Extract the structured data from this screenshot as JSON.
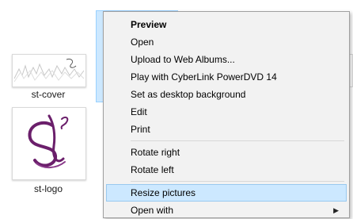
{
  "files": [
    {
      "name": "st-cover"
    },
    {
      "name": "st-logo"
    }
  ],
  "context_menu": {
    "items": [
      {
        "label": "Preview",
        "bold": true
      },
      {
        "label": "Open"
      },
      {
        "label": "Upload to Web Albums..."
      },
      {
        "label": "Play with CyberLink PowerDVD 14"
      },
      {
        "label": "Set as desktop background"
      },
      {
        "label": "Edit"
      },
      {
        "label": "Print"
      },
      {
        "label": "Rotate right"
      },
      {
        "label": "Rotate left"
      },
      {
        "label": "Resize pictures",
        "highlighted": true
      },
      {
        "label": "Open with",
        "has_submenu": true
      }
    ]
  },
  "colors": {
    "selection_fill": "#cce8ff",
    "selection_border": "#99d1ff",
    "menu_background": "#f2f2f2",
    "logo_purple": "#6b1f6b"
  },
  "icons": {
    "submenu": "chevron-right-icon"
  }
}
